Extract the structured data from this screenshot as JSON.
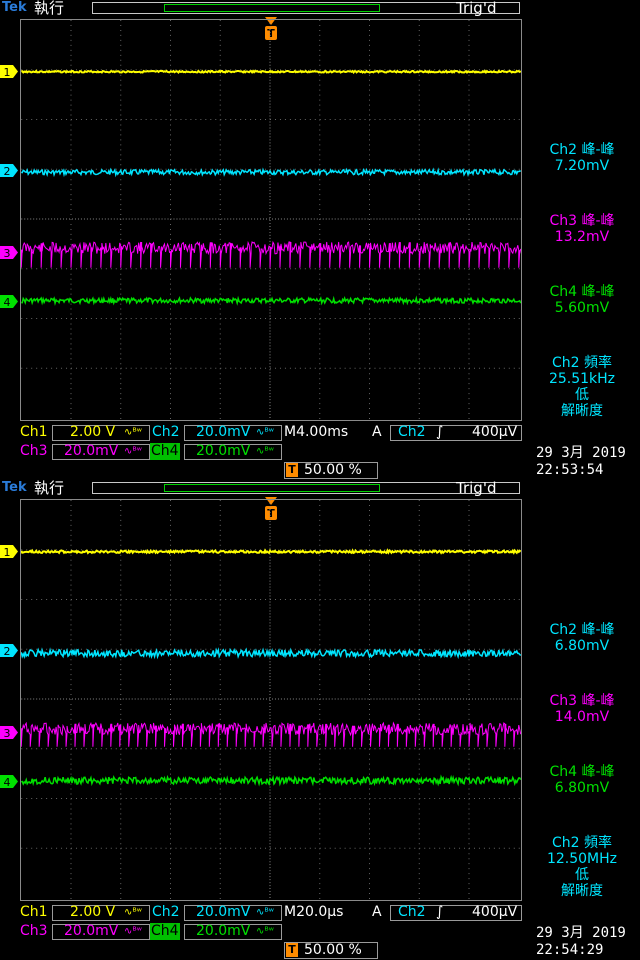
{
  "colors": {
    "ch1": "#ffff00",
    "ch2": "#00e5ff",
    "ch3": "#ff00ff",
    "ch4": "#00e000",
    "label": "#ffff00",
    "grid": "#777777",
    "accent": "#ff8c00",
    "tek": "#2a7bd8"
  },
  "screens": [
    {
      "brand": "Tek",
      "run_state": "執行",
      "trigger_state": "Trig'd",
      "channel_markers": [
        "1",
        "2",
        "3",
        "4"
      ],
      "trigger_marker": "T",
      "meas": [
        {
          "label": "Ch2 峰-峰",
          "value": "7.20mV",
          "color": "#00e5ff"
        },
        {
          "label": "Ch3 峰-峰",
          "value": "13.2mV",
          "color": "#ff00ff"
        },
        {
          "label": "Ch4 峰-峰",
          "value": "5.60mV",
          "color": "#00e000"
        }
      ],
      "freq": {
        "label": "Ch2 頻率",
        "value": "25.51kHz",
        "low": "低",
        "res": "解晰度"
      },
      "row1": {
        "ch1": "Ch1",
        "ch1_scale": "2.00 V",
        "ch2": "Ch2",
        "ch2_scale": "20.0mV",
        "timebase": "M4.00ms",
        "mode": "A",
        "trig_src": "Ch2",
        "trig_slope": "∫",
        "trig_level": "400µV"
      },
      "row2": {
        "ch3": "Ch3",
        "ch3_scale": "20.0mV",
        "ch4": "Ch4",
        "ch4_scale": "20.0mV",
        "pct_icon": "T",
        "pct": "50.00 %"
      },
      "date": "29 3月  2019",
      "time": "22:53:54"
    },
    {
      "brand": "Tek",
      "run_state": "執行",
      "trigger_state": "Trig'd",
      "channel_markers": [
        "1",
        "2",
        "3",
        "4"
      ],
      "trigger_marker": "T",
      "meas": [
        {
          "label": "Ch2 峰-峰",
          "value": "6.80mV",
          "color": "#00e5ff"
        },
        {
          "label": "Ch3 峰-峰",
          "value": "14.0mV",
          "color": "#ff00ff"
        },
        {
          "label": "Ch4 峰-峰",
          "value": "6.80mV",
          "color": "#00e000"
        }
      ],
      "freq": {
        "label": "Ch2 頻率",
        "value": "12.50MHz",
        "low": "低",
        "res": "解晰度"
      },
      "row1": {
        "ch1": "Ch1",
        "ch1_scale": "2.00 V",
        "ch2": "Ch2",
        "ch2_scale": "20.0mV",
        "timebase": "M20.0µs",
        "mode": "A",
        "trig_src": "Ch2",
        "trig_slope": "∫",
        "trig_level": "400µV"
      },
      "row2": {
        "ch3": "Ch3",
        "ch3_scale": "20.0mV",
        "ch4": "Ch4",
        "ch4_scale": "20.0mV",
        "pct_icon": "T",
        "pct": "50.00 %"
      },
      "date": "29 3月  2019",
      "time": "22:54:29"
    }
  ]
}
